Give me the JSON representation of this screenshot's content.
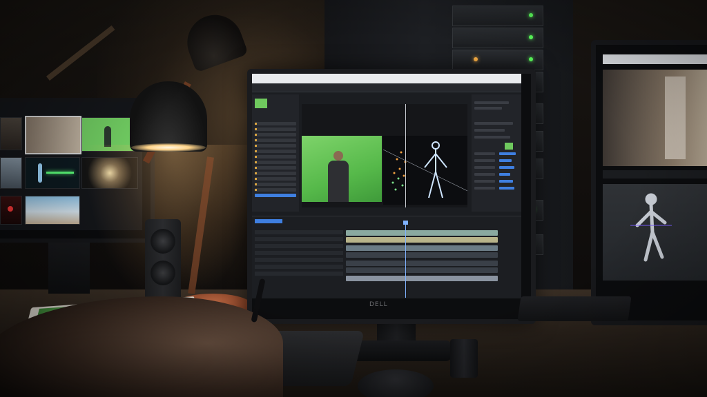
{
  "scene": {
    "description_colors": {
      "green_screen": "#6fc95e",
      "lamp_copper": "#b0603c",
      "ui_accent_blue": "#3f7fe0",
      "led_green": "#5cff5c"
    }
  },
  "main_monitor": {
    "brand": "DELL",
    "app": {
      "icons": [
        "skeleton-figure-icon",
        "particle-burst-icon",
        "green-screen-actor-icon"
      ]
    }
  },
  "icons": [
    "desk-lamp-icon",
    "speaker-icon",
    "pen-icon",
    "mouse-icon"
  ]
}
